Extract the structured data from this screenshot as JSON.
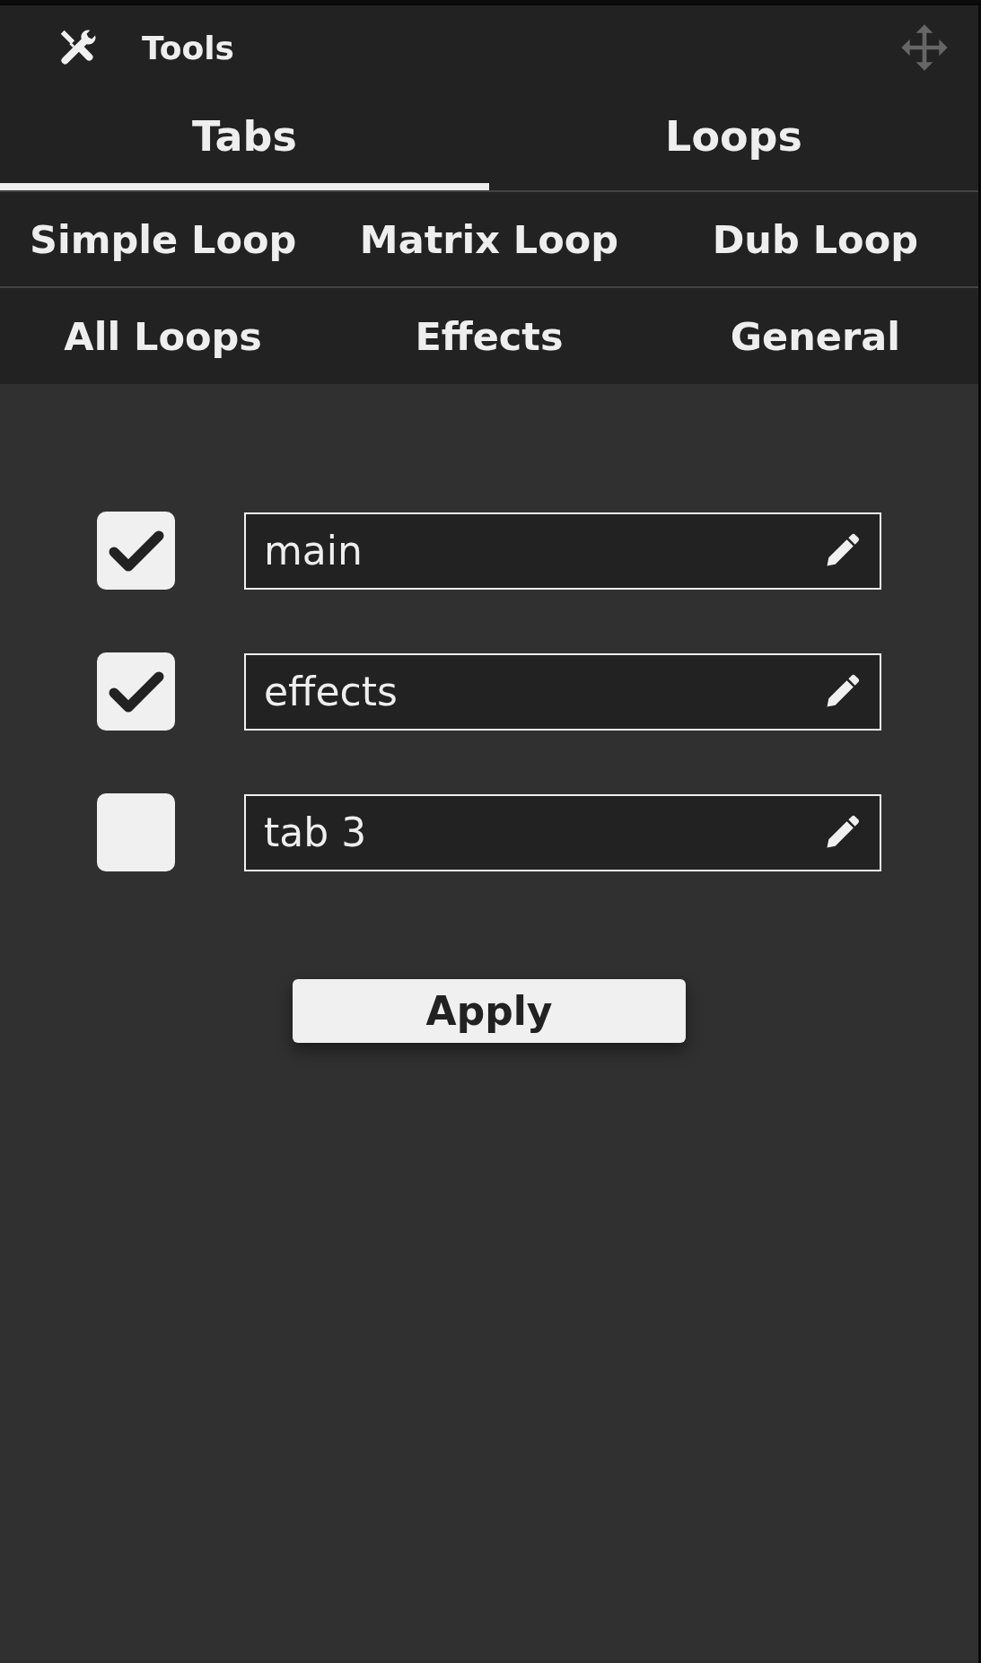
{
  "window": {
    "title": "Tools"
  },
  "tabs": [
    {
      "label": "Tabs",
      "selected": true
    },
    {
      "label": "Loops",
      "selected": false
    }
  ],
  "sub_tabs": [
    {
      "label": "Simple Loop"
    },
    {
      "label": "Matrix Loop"
    },
    {
      "label": "Dub Loop"
    },
    {
      "label": "All Loops"
    },
    {
      "label": "Effects"
    },
    {
      "label": "General"
    }
  ],
  "tab_list": [
    {
      "name": "main",
      "checked": true
    },
    {
      "name": "effects",
      "checked": true
    },
    {
      "name": "tab 3",
      "checked": false
    }
  ],
  "buttons": [
    "Apply"
  ]
}
